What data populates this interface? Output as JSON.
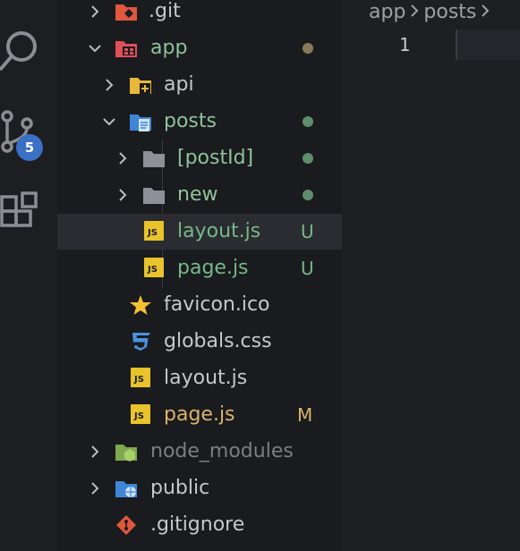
{
  "colors": {
    "folder_green": "#8fc29a",
    "file_default": "#c5c8ce",
    "dimmed": "#7b7e85",
    "untracked": "#76b887",
    "modified": "#d8b46a",
    "dot_green": "#5f8f6a",
    "dot_brown": "#8a7a5a",
    "badge": "#3c6fc6"
  },
  "activity_bar": {
    "icons": [
      "search-icon",
      "source-control-icon",
      "extensions-icon"
    ],
    "source_control_badge": "5"
  },
  "explorer": {
    "items": [
      {
        "label": ".git",
        "icon": "git-folder-icon",
        "expanded": false,
        "status": ""
      },
      {
        "label": "app",
        "icon": "app-folder-icon",
        "expanded": true,
        "status": "dot"
      },
      {
        "label": "api",
        "icon": "api-folder-icon",
        "expanded": false,
        "status": ""
      },
      {
        "label": "posts",
        "icon": "posts-folder-icon",
        "expanded": true,
        "status": "dot"
      },
      {
        "label": "[postId]",
        "icon": "folder-icon",
        "expanded": false,
        "status": "dot"
      },
      {
        "label": "new",
        "icon": "folder-icon",
        "expanded": false,
        "status": "dot"
      },
      {
        "label": "layout.js",
        "icon": "js-file-icon",
        "status": "U"
      },
      {
        "label": "page.js",
        "icon": "js-file-icon",
        "status": "U"
      },
      {
        "label": "favicon.ico",
        "icon": "star-icon",
        "status": ""
      },
      {
        "label": "globals.css",
        "icon": "css-file-icon",
        "status": ""
      },
      {
        "label": "layout.js",
        "icon": "js-file-icon",
        "status": ""
      },
      {
        "label": "page.js",
        "icon": "js-file-icon",
        "status": "M"
      },
      {
        "label": "node_modules",
        "icon": "node-folder-icon",
        "expanded": false,
        "status": ""
      },
      {
        "label": "public",
        "icon": "public-folder-icon",
        "expanded": false,
        "status": ""
      },
      {
        "label": ".gitignore",
        "icon": "git-file-icon",
        "status": ""
      }
    ],
    "js_badge_text": "JS"
  },
  "editor": {
    "breadcrumb": [
      "app",
      "posts"
    ],
    "line_number": "1"
  }
}
